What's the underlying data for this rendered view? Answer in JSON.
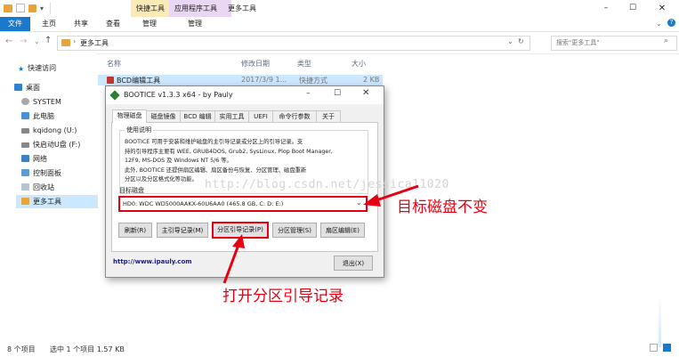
{
  "titlebar": {
    "context_tab_1": "快捷工具",
    "context_tab_2": "应用程序工具",
    "title": "更多工具"
  },
  "ribbon": {
    "file": "文件",
    "home": "主页",
    "share": "共享",
    "view": "查看",
    "manage_1": "管理",
    "manage_2": "管理"
  },
  "address": {
    "path": "更多工具",
    "search_placeholder": "搜索\"更多工具\""
  },
  "nav": {
    "items": [
      {
        "label": "快速访问"
      },
      {
        "label": "桌面"
      },
      {
        "label": "SYSTEM"
      },
      {
        "label": "此电脑"
      },
      {
        "label": "kqidong (U:)"
      },
      {
        "label": "快启动U盘 (F:)"
      },
      {
        "label": "网络"
      },
      {
        "label": "控制面板"
      },
      {
        "label": "回收站"
      },
      {
        "label": "更多工具"
      }
    ]
  },
  "files": {
    "columns": {
      "name": "名称",
      "date": "修改日期",
      "type": "类型",
      "size": "大小"
    },
    "row": {
      "name": "BCD编辑工具",
      "date": "2017/3/9 1...",
      "type": "快捷方式",
      "size": "2 KB"
    }
  },
  "status": {
    "count": "8 个项目",
    "selected": "选中 1 个项目  1.57 KB"
  },
  "dialog": {
    "title": "BOOTICE v1.3.3 x64 - by Pauly",
    "tabs": [
      "物理磁盘",
      "磁盘镜像",
      "BCD 编辑",
      "实用工具",
      "UEFI",
      "命令行参数",
      "关于"
    ],
    "usage_label": "使用说明",
    "usage_text": [
      "BOOTICE 可用于安装和维护磁盘的主引导记录或分区上的引导记录。支",
      "持的引导程序主要有 WEE, GRUB4DOS, Grub2, SysLinux, Plop Boot Manager,",
      "12F9, MS-DOS 及 Windows NT 5/6 等。",
      "此外, BOOTICE 还提供扇区编辑、扇区备份与恢复、分区管理、磁盘重新",
      "分区以及分区格式化等功能。"
    ],
    "target_label": "目标磁盘",
    "target_disk": "HD0: WDC WD5000AAKX-60U6AA0 (465.8 GB, C: D: E:)",
    "buttons": {
      "refresh": "刷新(R)",
      "mbr": "主引导记录(M)",
      "pbr": "分区引导记录(P)",
      "partition": "分区管理(S)",
      "sector": "扇区编辑(E)",
      "exit": "退出(X)"
    },
    "url": "http://www.ipauly.com"
  },
  "annotations": {
    "target_disk_note": "目标磁盘不变",
    "pbr_note": "打开分区引导记录"
  },
  "watermark": "http://blog.csdn.net/jessica11020",
  "colors": {
    "accent_blue": "#1979ca",
    "annotation_red": "#e60012",
    "tool_tab_yellow": "#f9eab6",
    "app_tab_purple": "#e9d7f4"
  }
}
